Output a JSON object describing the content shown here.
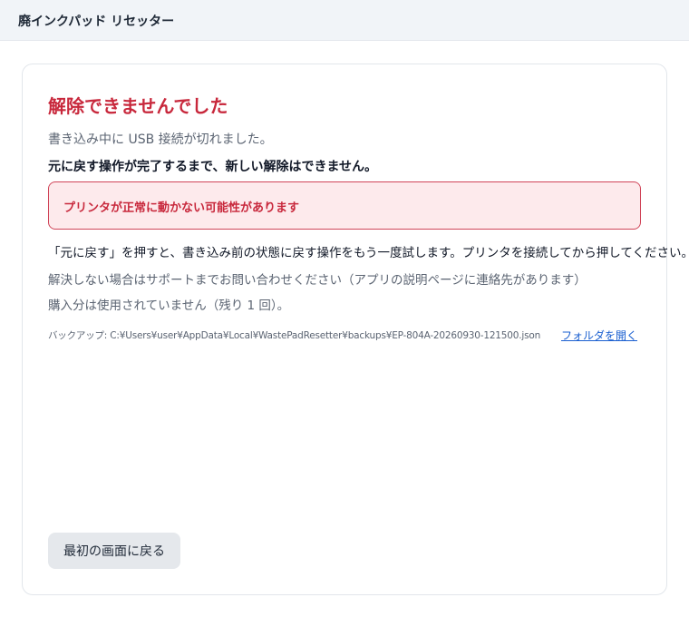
{
  "window": {
    "title": "廃インクパッド リセッター"
  },
  "result": {
    "heading": "解除できませんでした",
    "subtext": "書き込み中に USB 接続が切れました。",
    "notice": "元に戻す操作が完了するまで、新しい解除はできません。",
    "alert": "プリンタが正常に動かない可能性があります",
    "instruction": "「元に戻す」を押すと、書き込み前の状態に戻す操作をもう一度試します。プリンタを接続してから押してください。",
    "support": "解決しない場合はサポートまでお問い合わせください（アプリの説明ページに連絡先があります）",
    "usage": "購入分は使用されていません（残り 1 回）。",
    "backup_path": "バックアップ: C:¥Users¥user¥AppData¥Local¥WastePadResetter¥backups¥EP-804A-20260930-121500.json",
    "open_folder_label": "フォルダを開く",
    "back_button_label": "最初の画面に戻る"
  },
  "colors": {
    "error": "#c8283c",
    "alert_background": "#fdeaec",
    "link": "#1a5fd0"
  }
}
